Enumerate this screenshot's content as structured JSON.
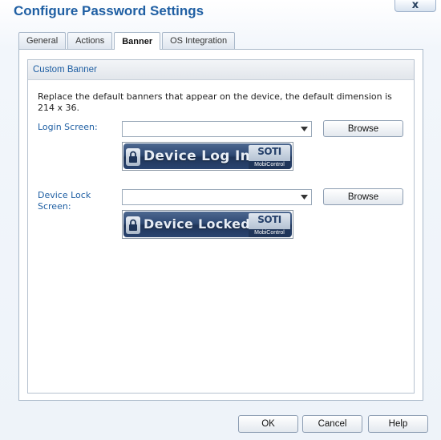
{
  "window": {
    "title": "Configure Password Settings",
    "close_glyph": "x"
  },
  "tabs": [
    {
      "label": "General",
      "active": false
    },
    {
      "label": "Actions",
      "active": false
    },
    {
      "label": "Banner",
      "active": true
    },
    {
      "label": "OS Integration",
      "active": false
    }
  ],
  "group": {
    "title": "Custom Banner"
  },
  "description": "Replace the default banners that appear on the device, the default dimension is 214 x 36.",
  "login_screen": {
    "label": "Login Screen:",
    "value": "",
    "browse_label": "Browse",
    "banner_text": "Device Log In",
    "logo_text": "SOTI",
    "logo_sub": "MobiControl"
  },
  "device_lock_screen": {
    "label": "Device Lock Screen:",
    "value": "",
    "browse_label": "Browse",
    "banner_text": "Device Locked",
    "logo_text": "SOTI",
    "logo_sub": "MobiControl"
  },
  "footer": {
    "ok_label": "OK",
    "cancel_label": "Cancel",
    "help_label": "Help"
  },
  "colors": {
    "title": "#1f5fa3",
    "label": "#1f5fa3",
    "banner_bg": "#2f4a74"
  },
  "icons": {
    "dropdown": "chevron-down-icon",
    "lock": "padlock-icon",
    "close": "close-icon"
  }
}
